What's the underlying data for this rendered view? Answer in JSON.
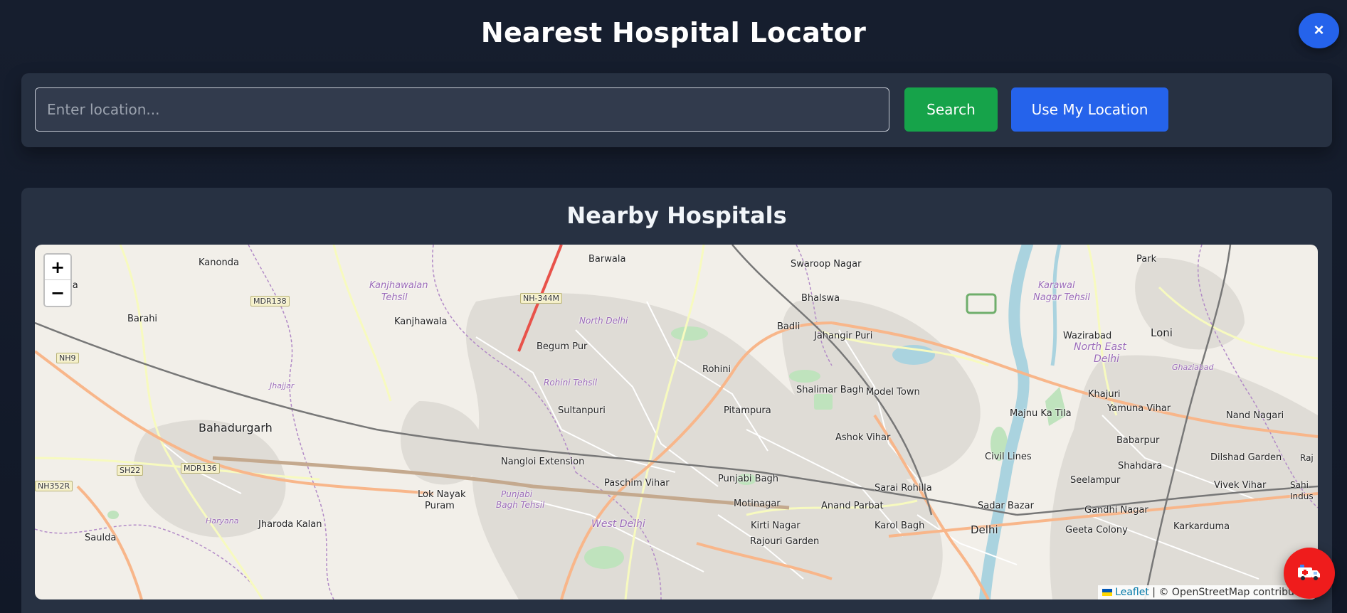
{
  "header": {
    "title": "Nearest Hospital Locator",
    "close_icon": "×"
  },
  "search": {
    "placeholder": "Enter location...",
    "value": "",
    "search_label": "Search",
    "locate_label": "Use My Location"
  },
  "hospitals": {
    "title": "Nearby Hospitals"
  },
  "map": {
    "zoom_in": "+",
    "zoom_out": "−",
    "attribution": {
      "leaflet": "Leaflet",
      "separator": " | ",
      "osm": "© OpenStreetMap contributors"
    },
    "labels": [
      {
        "text": "Kanonda"
      },
      {
        "text": "Barwala"
      },
      {
        "text": "Swaroop Nagar"
      },
      {
        "text": "Park"
      },
      {
        "text": "audha"
      },
      {
        "text": "MDR138"
      },
      {
        "text": "Kanjhawalan"
      },
      {
        "text": "Tehsil"
      },
      {
        "text": "NH-344M"
      },
      {
        "text": "Bhalswa"
      },
      {
        "text": "Karawal"
      },
      {
        "text": "Nagar Tehsil"
      },
      {
        "text": "Barahi"
      },
      {
        "text": "Kanjhawala"
      },
      {
        "text": "North Delhi"
      },
      {
        "text": "Badli"
      },
      {
        "text": "Jahangir Puri"
      },
      {
        "text": "Wazirabad"
      },
      {
        "text": "Loni"
      },
      {
        "text": "Begum Pur"
      },
      {
        "text": "North East"
      },
      {
        "text": "Delhi"
      },
      {
        "text": "NH9"
      },
      {
        "text": "Rohini"
      },
      {
        "text": "Ghaziabad"
      },
      {
        "text": "Rohini Tehsil"
      },
      {
        "text": "Jhajjar"
      },
      {
        "text": "Shalimar Bagh"
      },
      {
        "text": "Model Town"
      },
      {
        "text": "Khajuri"
      },
      {
        "text": "Sultanpuri"
      },
      {
        "text": "Pitampura"
      },
      {
        "text": "Majnu Ka Tila"
      },
      {
        "text": "Yamuna Vihar"
      },
      {
        "text": "Nand Nagari"
      },
      {
        "text": "Bahadurgarh"
      },
      {
        "text": "Ashok Vihar"
      },
      {
        "text": "Babarpur"
      },
      {
        "text": "Civil Lines"
      },
      {
        "text": "Dilshad Garden"
      },
      {
        "text": "Raj"
      },
      {
        "text": "Nangloi Extension"
      },
      {
        "text": "SH22"
      },
      {
        "text": "MDR136"
      },
      {
        "text": "Shahdara"
      },
      {
        "text": "Paschim Vihar"
      },
      {
        "text": "Punjabi Bagh"
      },
      {
        "text": "Seelampur"
      },
      {
        "text": "Vivek Vihar"
      },
      {
        "text": "Sahi"
      },
      {
        "text": "Indus"
      },
      {
        "text": "NH352R"
      },
      {
        "text": "Sarai Rohilla"
      },
      {
        "text": "Lok Nayak"
      },
      {
        "text": "Puram"
      },
      {
        "text": "Punjabi"
      },
      {
        "text": "Bagh Tehsil"
      },
      {
        "text": "Motinagar"
      },
      {
        "text": "Anand Parbat"
      },
      {
        "text": "Sadar Bazar"
      },
      {
        "text": "Gandhi Nagar"
      },
      {
        "text": "West Delhi"
      },
      {
        "text": "Jharoda Kalan"
      },
      {
        "text": "Haryana"
      },
      {
        "text": "Kirti Nagar"
      },
      {
        "text": "Karol Bagh"
      },
      {
        "text": "Delhi"
      },
      {
        "text": "Geeta Colony"
      },
      {
        "text": "Karkarduma"
      },
      {
        "text": "Saulda"
      },
      {
        "text": "Rajouri Garden"
      }
    ]
  },
  "fab": {
    "icon": "ambulance-icon"
  },
  "colors": {
    "primary_blue": "#2563eb",
    "search_green": "#16a34a",
    "fab_red": "#ef1c1c",
    "panel": "#273142",
    "background": "#111827"
  }
}
